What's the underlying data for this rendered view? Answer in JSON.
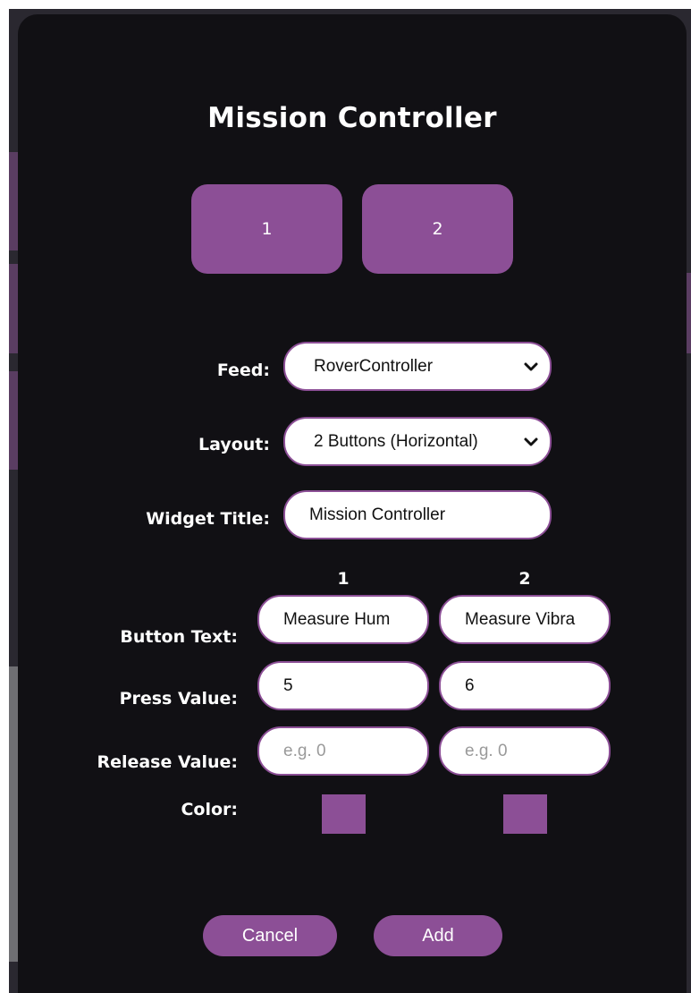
{
  "dialog": {
    "title": "Mission Controller",
    "accent_color": "#8c4f96",
    "background_color": "#111014"
  },
  "preview": {
    "buttons": [
      {
        "label": "1"
      },
      {
        "label": "2"
      }
    ]
  },
  "form": {
    "feed": {
      "label": "Feed:",
      "value": "RoverController",
      "icon": "chevron-down-icon"
    },
    "layout": {
      "label": "Layout:",
      "value": "2 Buttons (Horizontal)",
      "icon": "chevron-down-icon"
    },
    "widget_title": {
      "label": "Widget Title:",
      "value": "Mission Controller"
    },
    "columns": [
      "1",
      "2"
    ],
    "button_text": {
      "label": "Button Text:",
      "values": [
        "Measure Hum",
        "Measure Vibra"
      ]
    },
    "press_value": {
      "label": "Press Value:",
      "values": [
        "5",
        "6"
      ]
    },
    "release_value": {
      "label": "Release Value:",
      "placeholders": [
        "e.g. 0",
        "e.g. 0"
      ]
    },
    "color": {
      "label": "Color:",
      "values": [
        "#8c4f96",
        "#8c4f96"
      ]
    }
  },
  "actions": {
    "cancel_label": "Cancel",
    "add_label": "Add"
  }
}
